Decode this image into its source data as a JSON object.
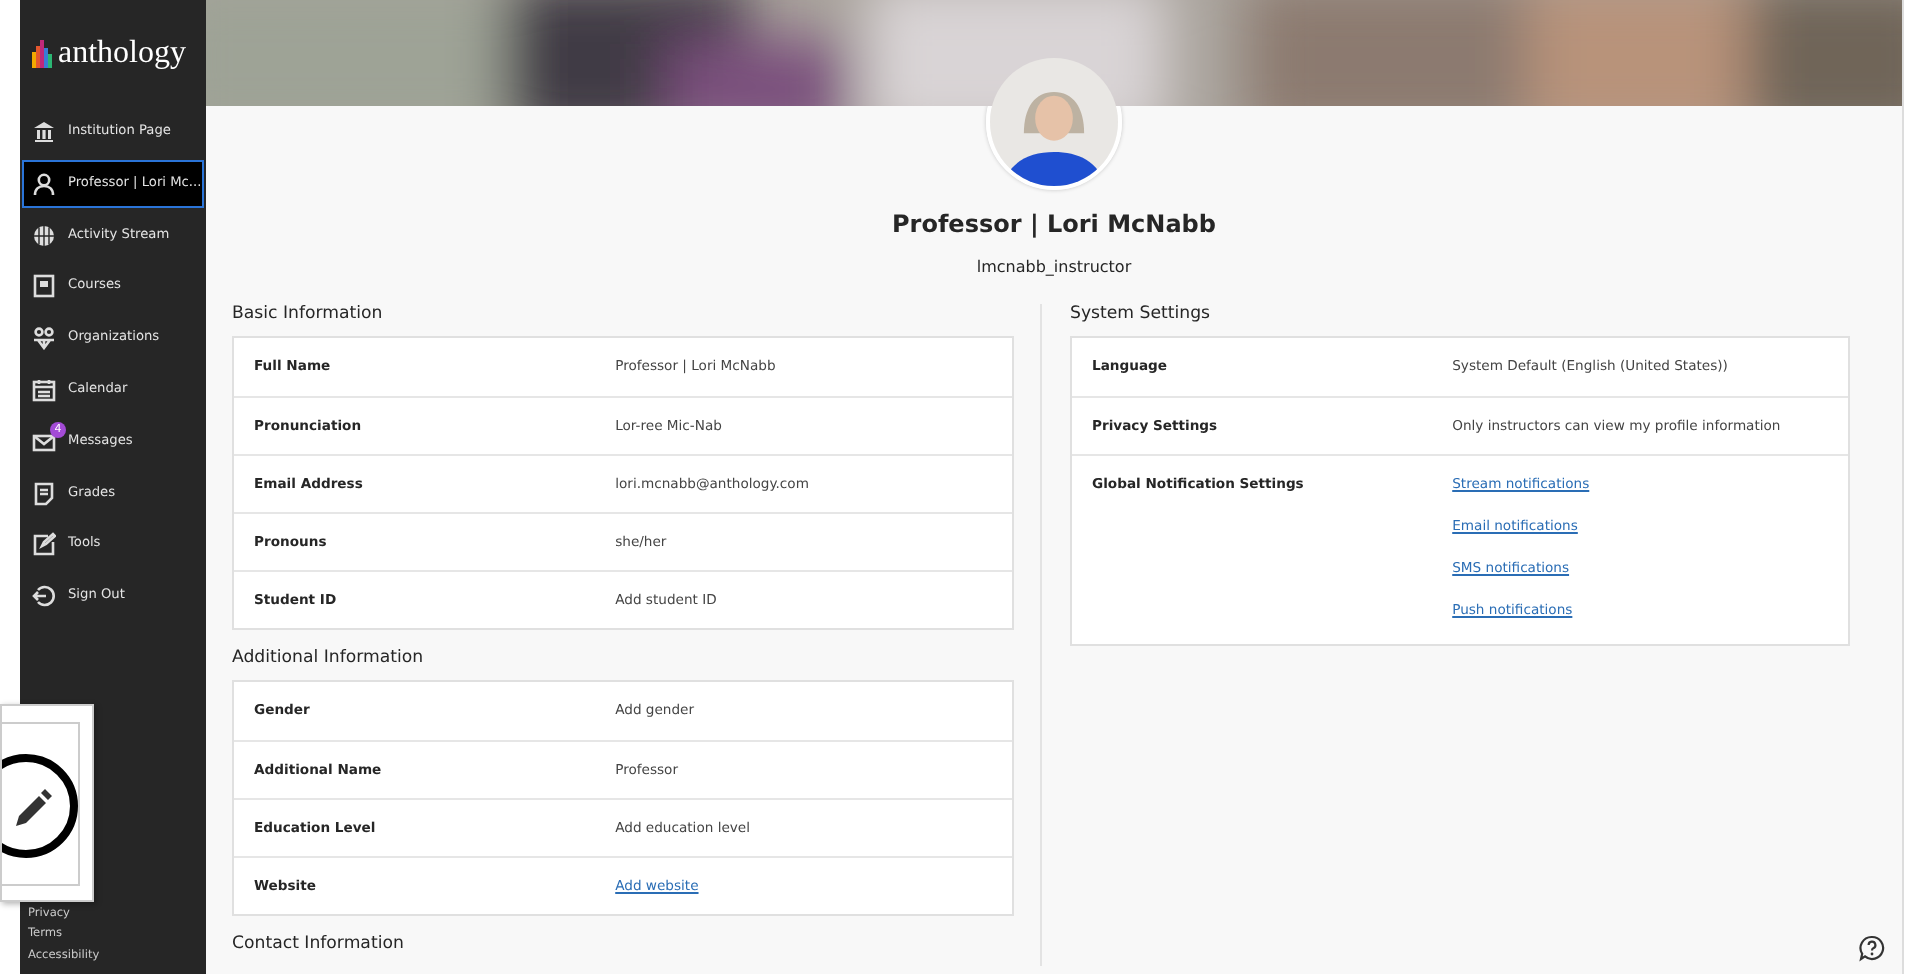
{
  "sidebar": {
    "logo": "anthology",
    "items": [
      {
        "label": "Institution Page",
        "selected": false
      },
      {
        "label": "Professor | Lori Mc...",
        "selected": true
      },
      {
        "label": "Activity Stream",
        "selected": false
      },
      {
        "label": "Courses",
        "selected": false
      },
      {
        "label": "Organizations",
        "selected": false
      },
      {
        "label": "Calendar",
        "selected": false
      },
      {
        "label": "Messages",
        "selected": false,
        "badge": "4"
      },
      {
        "label": "Grades",
        "selected": false
      },
      {
        "label": "Tools",
        "selected": false
      },
      {
        "label": "Sign Out",
        "selected": false
      }
    ],
    "footer_links": [
      "Privacy",
      "Terms",
      "Accessibility"
    ]
  },
  "profile": {
    "name": "Professor | Lori McNabb",
    "username": "lmcnabb_instructor"
  },
  "left_sections": [
    {
      "title": "Basic Information",
      "rows": [
        {
          "label": "Full Name",
          "kind": "text",
          "value": "Professor | Lori McNabb"
        },
        {
          "label": "Pronunciation",
          "kind": "text",
          "value": "Lor-ree Mic-Nab"
        },
        {
          "label": "Email Address",
          "kind": "text",
          "value": "lori.mcnabb@anthology.com"
        },
        {
          "label": "Pronouns",
          "kind": "text",
          "value": "she/her"
        },
        {
          "label": "Student ID",
          "kind": "text",
          "value": "Add student ID"
        }
      ]
    },
    {
      "title": "Additional Information",
      "rows": [
        {
          "label": "Gender",
          "kind": "text",
          "value": "Add gender"
        },
        {
          "label": "Additional Name",
          "kind": "text",
          "value": "Professor"
        },
        {
          "label": "Education Level",
          "kind": "text",
          "value": "Add education level"
        },
        {
          "label": "Website",
          "kind": "link",
          "value": "Add website"
        }
      ]
    },
    {
      "title": "Contact Information"
    }
  ],
  "right_sections": [
    {
      "title": "System Settings",
      "rows": [
        {
          "label": "Language",
          "kind": "text",
          "value": "System Default (English (United States))"
        },
        {
          "label": "Privacy Settings",
          "kind": "text",
          "value": "Only instructors can view my profile information"
        },
        {
          "label": "Global Notification Settings",
          "kind": "links",
          "values": [
            "Stream notifications",
            "Email notifications",
            "SMS notifications",
            "Push notifications"
          ]
        }
      ]
    }
  ]
}
